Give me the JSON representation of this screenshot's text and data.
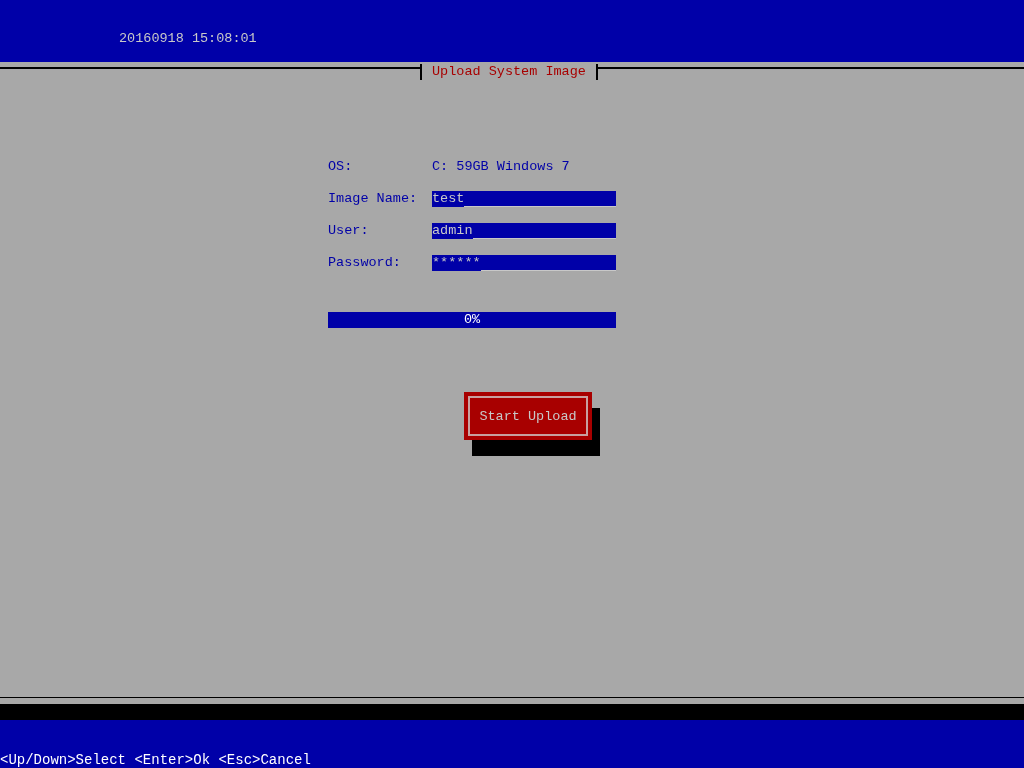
{
  "header": {
    "datetime": "20160918 15:08:01"
  },
  "dialog": {
    "title": "Upload System Image",
    "rows": [
      {
        "kind": "text",
        "label": "OS:",
        "value": "C: 59GB Windows 7"
      },
      {
        "kind": "field",
        "label": "Image Name:",
        "value": "test"
      },
      {
        "kind": "field",
        "label": "User:",
        "value": "admin"
      },
      {
        "kind": "field",
        "label": "Password:",
        "value": "******"
      }
    ],
    "progress": {
      "level": 0,
      "reading": "0%"
    },
    "button": "Start Upload"
  },
  "status_bar": {
    "hint": "<Up/Down>Select <Enter>Ok <Esc>Cancel"
  }
}
